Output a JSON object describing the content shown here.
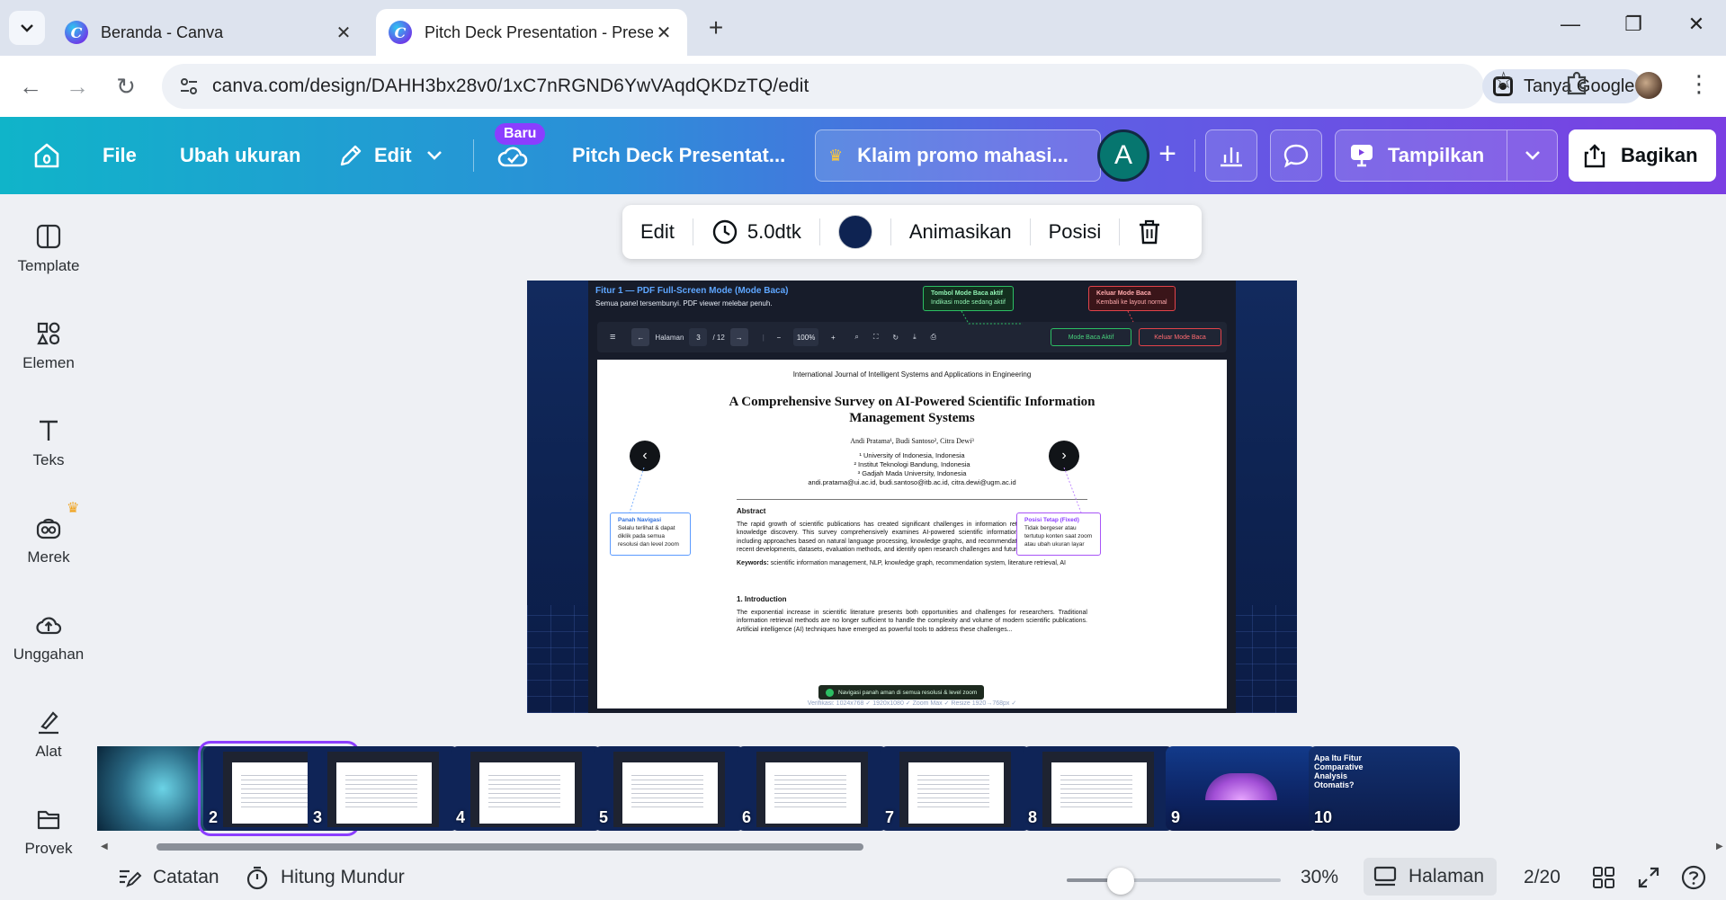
{
  "browser": {
    "tabs": [
      {
        "title": "Beranda - Canva",
        "active": false
      },
      {
        "title": "Pitch Deck Presentation - Presentation",
        "active": true
      }
    ],
    "url": "canva.com/design/DAHH3bx28v0/1xC7nRGND6YwVAqdQKDzTQ/edit",
    "google_chip": "Tanya Google"
  },
  "header": {
    "file": "File",
    "resize": "Ubah ukuran",
    "edit": "Edit",
    "new_badge": "Baru",
    "doc_title": "Pitch Deck Presentat...",
    "promo": "Klaim promo mahasi...",
    "avatar_initial": "A",
    "present": "Tampilkan",
    "share": "Bagikan"
  },
  "sidebar": {
    "items": [
      {
        "label": "Template",
        "icon": "template-icon"
      },
      {
        "label": "Elemen",
        "icon": "elements-icon"
      },
      {
        "label": "Teks",
        "icon": "text-icon"
      },
      {
        "label": "Merek",
        "icon": "brand-icon"
      },
      {
        "label": "Unggahan",
        "icon": "upload-icon"
      },
      {
        "label": "Alat",
        "icon": "tools-icon"
      },
      {
        "label": "Proyek",
        "icon": "folder-icon"
      }
    ]
  },
  "float_toolbar": {
    "edit": "Edit",
    "duration": "5.0dtk",
    "color": "#0e2352",
    "animate": "Animasikan",
    "position": "Posisi"
  },
  "slide": {
    "title": "Fitur 1 — PDF Full-Screen Mode (Mode Baca)",
    "subtitle": "Semua panel tersembunyi. PDF viewer melebar penuh.",
    "callout_green_title": "Tombol Mode Baca aktif",
    "callout_green_text": "Indikasi mode sedang aktif",
    "callout_red_title": "Keluar Mode Baca",
    "callout_red_text": "Kembali ke layout normal",
    "toolbar": {
      "page_label": "Halaman",
      "page_current": "3",
      "page_total": "/ 12",
      "zoom": "100%",
      "mode_active": "Mode Baca Aktif",
      "mode_exit": "Keluar Mode Baca"
    },
    "paper": {
      "journal": "International Journal of Intelligent Systems and Applications in Engineering",
      "title": "A Comprehensive Survey on AI-Powered Scientific Information Management Systems",
      "authors": "Andi Pratama¹, Budi Santoso², Citra Dewi³",
      "affil_1": "¹ University of Indonesia, Indonesia",
      "affil_2": "² Institut Teknologi Bandung, Indonesia",
      "affil_3": "³ Gadjah Mada University, Indonesia",
      "emails": "andi.pratama@ui.ac.id, budi.santoso@itb.ac.id, citra.dewi@ugm.ac.id",
      "abstract_heading": "Abstract",
      "abstract": "The rapid growth of scientific publications has created significant challenges in information retrieval, organization, and knowledge discovery. This survey comprehensively examines AI-powered scientific information management systems, including approaches based on natural language processing, knowledge graphs, and recommendation systems. We analyze recent developments, datasets, evaluation methods, and identify open research challenges and future directions.",
      "keywords_label": "Keywords:",
      "keywords": "scientific information management, NLP, knowledge graph, recommendation system, literature retrieval, AI",
      "intro_heading": "1. Introduction",
      "intro": "The exponential increase in scientific literature presents both opportunities and challenges for researchers. Traditional information retrieval methods are no longer sufficient to handle the complexity and volume of modern scientific publications. Artificial intelligence (AI) techniques have emerged as powerful tools to address these challenges..."
    },
    "callout_blue_title": "Panah Navigasi",
    "callout_blue_text": "Selalu terlihat & dapat diklik pada semua resolusi dan level zoom",
    "callout_purple_title": "Posisi Tetap (Fixed)",
    "callout_purple_text": "Tidak bergeser atau tertutup konten saat zoom atau ubah ukuran layar",
    "toast": "Navigasi panah aman di semua resolusi & level zoom",
    "verify": "Verifikasi: 1024x768 ✓     1920x1080 ✓     Zoom Max ✓     Resize 1920→768px ✓"
  },
  "thumbnails": [
    {
      "num": "",
      "style": "globe"
    },
    {
      "num": "2",
      "style": "doc",
      "selected": true
    },
    {
      "num": "3",
      "style": "doc"
    },
    {
      "num": "4",
      "style": "doc"
    },
    {
      "num": "5",
      "style": "doc"
    },
    {
      "num": "6",
      "style": "doc"
    },
    {
      "num": "7",
      "style": "doc"
    },
    {
      "num": "8",
      "style": "doc"
    },
    {
      "num": "9",
      "style": "dome"
    },
    {
      "num": "10",
      "style": "text",
      "text": "Apa Itu Fitur Comparative Analysis Otomatis?"
    }
  ],
  "footer": {
    "notes": "Catatan",
    "timer": "Hitung Mundur",
    "zoom_pct": "30%",
    "zoom_level": 0.25,
    "pages": "Halaman",
    "page_count": "2/20"
  }
}
